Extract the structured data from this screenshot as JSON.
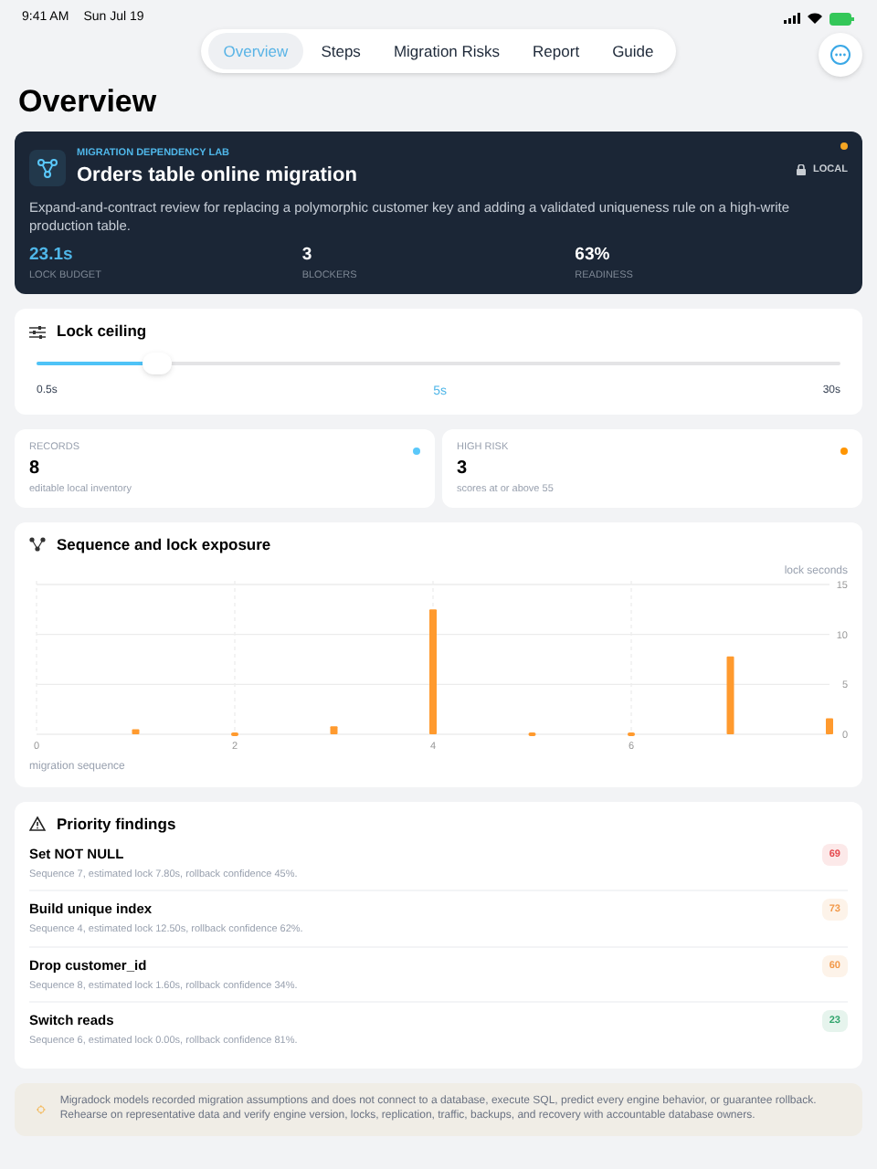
{
  "status_bar": {
    "time": "9:41 AM",
    "date": "Sun Jul 19"
  },
  "tabs": [
    {
      "label": "Overview",
      "selected": true
    },
    {
      "label": "Steps",
      "selected": false
    },
    {
      "label": "Migration Risks",
      "selected": false
    },
    {
      "label": "Report",
      "selected": false
    },
    {
      "label": "Guide",
      "selected": false
    }
  ],
  "page_title": "Overview",
  "hero": {
    "eyebrow": "MIGRATION DEPENDENCY LAB",
    "title": "Orders table online migration",
    "badge": "LOCAL",
    "description": "Expand-and-contract review for replacing a polymorphic customer key and adding a validated uniqueness rule on a high-write production table.",
    "metrics": [
      {
        "value": "23.1s",
        "label": "LOCK BUDGET",
        "highlight": true
      },
      {
        "value": "3",
        "label": "BLOCKERS",
        "highlight": false
      },
      {
        "value": "63%",
        "label": "READINESS",
        "highlight": false
      }
    ]
  },
  "lock_ceiling": {
    "title": "Lock ceiling",
    "level": 0.15,
    "min": "0.5s",
    "value": "5s",
    "max": "30s"
  },
  "stats": [
    {
      "label": "RECORDS",
      "value": "8",
      "caption": "editable local inventory",
      "color": "#5ac8fa"
    },
    {
      "label": "HIGH RISK",
      "value": "3",
      "caption": "scores at or above 55",
      "color": "#ff9500"
    }
  ],
  "chart_card": {
    "title": "Sequence and lock exposure",
    "chart_data": {
      "type": "bar",
      "xlabel": "migration sequence",
      "x": [
        1,
        2,
        3,
        4,
        5,
        6,
        7,
        8
      ],
      "series": [
        {
          "name": "lock seconds",
          "color": "#ff9a2e",
          "values": [
            0.5,
            0,
            0.8,
            12.5,
            0,
            0,
            7.8,
            1.6
          ]
        }
      ],
      "grid": true,
      "xlim": [
        0,
        8
      ],
      "ylim": [
        0,
        15
      ],
      "xticks": [
        0,
        2,
        4,
        6
      ],
      "yticks": [
        0,
        5,
        10,
        15
      ]
    }
  },
  "findings": {
    "title": "Priority findings",
    "items": [
      {
        "name": "Set NOT NULL",
        "detail": "Sequence 7, estimated lock 7.80s, rollback confidence 45%.",
        "score": "69",
        "color": "#e5484d"
      },
      {
        "name": "Build unique index",
        "detail": "Sequence 4, estimated lock 12.50s, rollback confidence 62%.",
        "score": "73",
        "color": "#f2994a"
      },
      {
        "name": "Drop customer_id",
        "detail": "Sequence 8, estimated lock 1.60s, rollback confidence 34%.",
        "score": "60",
        "color": "#f2994a"
      },
      {
        "name": "Switch reads",
        "detail": "Sequence 6, estimated lock 0.00s, rollback confidence 81%.",
        "score": "23",
        "color": "#30a46c"
      }
    ]
  },
  "disclaimer": "Migradock models recorded migration assumptions and does not connect to a database, execute SQL, predict every engine behavior, or guarantee rollback. Rehearse on representative data and verify engine version, locks, replication, traffic, backups, and recovery with accountable database owners."
}
